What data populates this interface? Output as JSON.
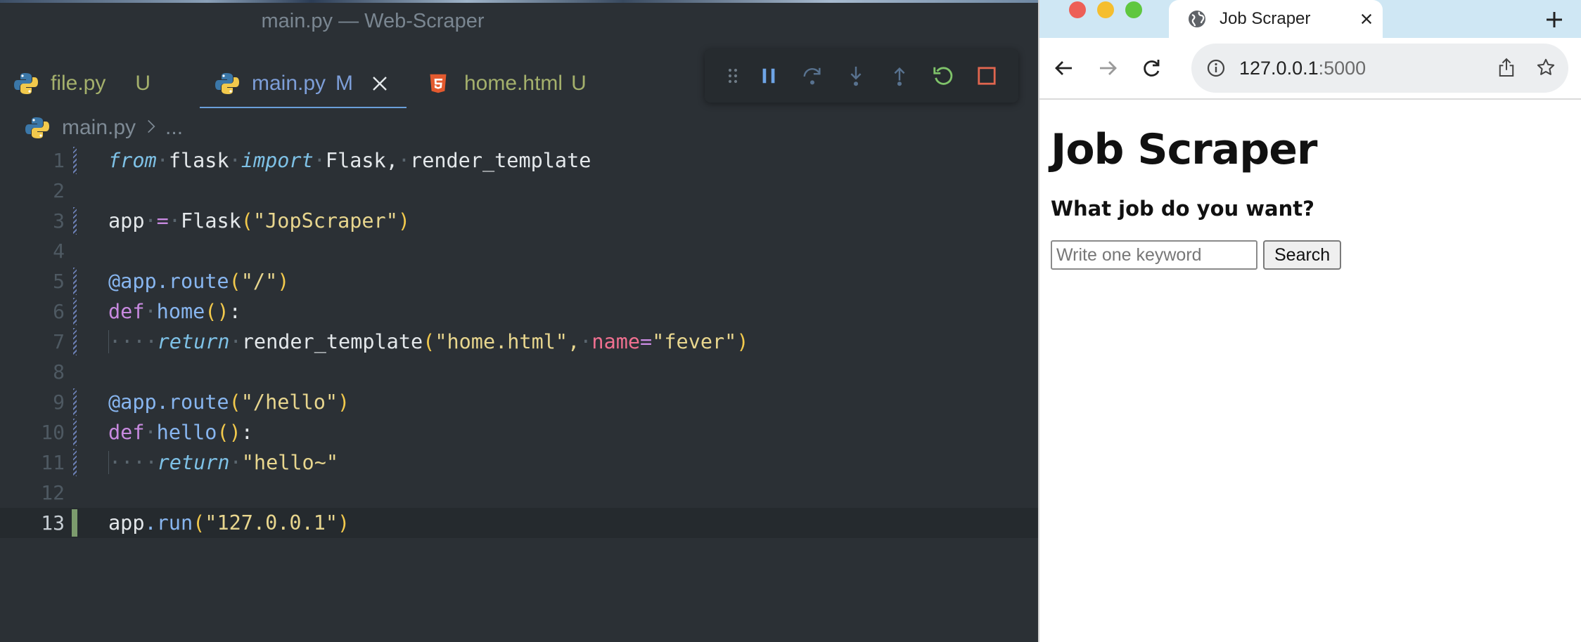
{
  "editor": {
    "window_title": "main.py — Web-Scraper",
    "tabs": [
      {
        "label": "file.py",
        "status": "U"
      },
      {
        "label": "main.py",
        "status": "M"
      },
      {
        "label": "home.html",
        "status": "U"
      }
    ],
    "breadcrumb": {
      "file": "main.py",
      "ellipsis": "..."
    },
    "debug_toolbar": [
      "drag-handle-icon",
      "pause-icon",
      "step-over-icon",
      "step-into-icon",
      "step-out-icon",
      "restart-icon",
      "stop-icon"
    ],
    "line_numbers": [
      "1",
      "2",
      "3",
      "4",
      "5",
      "6",
      "7",
      "8",
      "9",
      "10",
      "11",
      "12",
      "13"
    ],
    "active_line": "13",
    "code": {
      "l1": {
        "from": "from",
        "mod": "flask",
        "import": "import",
        "names": "Flask,",
        "names2": "render_template"
      },
      "l3": {
        "var": "app",
        "eq": "=",
        "cls": "Flask",
        "open": "(",
        "str": "\"JopScraper\"",
        "close": ")"
      },
      "l5": {
        "dec": "@app.route",
        "open": "(",
        "str": "\"/\"",
        "close": ")"
      },
      "l6": {
        "def": "def",
        "name": "home",
        "parens": "()",
        "colon": ":"
      },
      "l7": {
        "ret": "return",
        "fn": "render_template",
        "open": "(",
        "str1": "\"home.html\",",
        "kw": "name",
        "eq": "=",
        "str2": "\"fever\"",
        "close": ")"
      },
      "l9": {
        "dec": "@app.route",
        "open": "(",
        "str": "\"/hello\"",
        "close": ")"
      },
      "l10": {
        "def": "def",
        "name": "hello",
        "parens": "()",
        "colon": ":"
      },
      "l11": {
        "ret": "return",
        "str": "\"hello~\""
      },
      "l13": {
        "obj": "app",
        "method": ".run",
        "open": "(",
        "str": "\"127.0.0.1\"",
        "close": ")"
      }
    },
    "colors": {
      "background": "#2b3035",
      "keyword": "#7ec1e6",
      "string": "#e8d68e",
      "function": "#88b6f0"
    }
  },
  "browser": {
    "tab_title": "Job Scraper",
    "url_host": "127.0.0.1",
    "url_port": ":5000",
    "page": {
      "heading": "Job Scraper",
      "subheading": "What job do you want?",
      "input_placeholder": "Write one keyword",
      "button_label": "Search"
    }
  }
}
